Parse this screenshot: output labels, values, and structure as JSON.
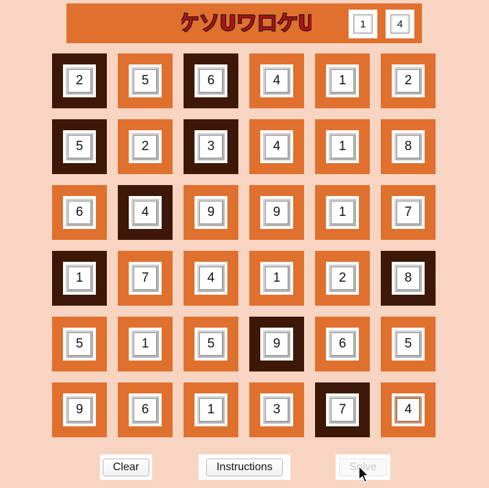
{
  "header": {
    "logo_text": "ケソUワロケU",
    "counter_left": "1",
    "counter_right": "4"
  },
  "grid": {
    "rows": [
      [
        {
          "value": "2",
          "shaded": true
        },
        {
          "value": "5",
          "shaded": false
        },
        {
          "value": "6",
          "shaded": true
        },
        {
          "value": "4",
          "shaded": false
        },
        {
          "value": "1",
          "shaded": false
        },
        {
          "value": "2",
          "shaded": false
        }
      ],
      [
        {
          "value": "5",
          "shaded": true
        },
        {
          "value": "2",
          "shaded": false
        },
        {
          "value": "3",
          "shaded": true
        },
        {
          "value": "4",
          "shaded": false
        },
        {
          "value": "1",
          "shaded": false
        },
        {
          "value": "8",
          "shaded": false
        }
      ],
      [
        {
          "value": "6",
          "shaded": false
        },
        {
          "value": "4",
          "shaded": true
        },
        {
          "value": "9",
          "shaded": false
        },
        {
          "value": "9",
          "shaded": false
        },
        {
          "value": "1",
          "shaded": false
        },
        {
          "value": "7",
          "shaded": false
        }
      ],
      [
        {
          "value": "1",
          "shaded": true
        },
        {
          "value": "7",
          "shaded": false
        },
        {
          "value": "4",
          "shaded": false
        },
        {
          "value": "1",
          "shaded": false
        },
        {
          "value": "2",
          "shaded": false
        },
        {
          "value": "8",
          "shaded": true
        }
      ],
      [
        {
          "value": "5",
          "shaded": false
        },
        {
          "value": "1",
          "shaded": false
        },
        {
          "value": "5",
          "shaded": false
        },
        {
          "value": "9",
          "shaded": true
        },
        {
          "value": "6",
          "shaded": false
        },
        {
          "value": "5",
          "shaded": false
        }
      ],
      [
        {
          "value": "9",
          "shaded": false
        },
        {
          "value": "6",
          "shaded": false
        },
        {
          "value": "1",
          "shaded": false
        },
        {
          "value": "3",
          "shaded": false
        },
        {
          "value": "7",
          "shaded": true
        },
        {
          "value": "4",
          "shaded": false,
          "selected": true
        }
      ]
    ]
  },
  "buttons": {
    "clear_label": "Clear",
    "instructions_label": "Instructions",
    "solve_label": "Solve",
    "solve_enabled": false
  },
  "colors": {
    "background": "#f8d5c3",
    "cell_unshaded": "#e0702e",
    "cell_shaded": "#3d1707",
    "logo_fill": "#b01313"
  },
  "icons": {
    "pointer": "arrow-cursor-icon"
  }
}
